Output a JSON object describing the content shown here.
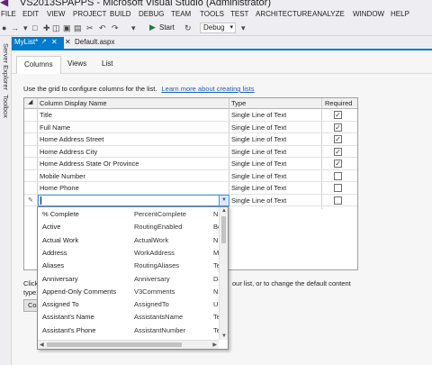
{
  "window": {
    "title": "VS2013SPAPPS - Microsoft Visual Studio (Administrator)"
  },
  "menu": [
    "FILE",
    "EDIT",
    "VIEW",
    "PROJECT",
    "BUILD",
    "DEBUG",
    "TEAM",
    "TOOLS",
    "TEST",
    "ARCHITECTURE",
    "ANALYZE",
    "WINDOW",
    "HELP"
  ],
  "toolbar": {
    "start_label": "Start",
    "config_label": "Debug"
  },
  "side": {
    "server_explorer": "Server Explorer",
    "toolbox": "Toolbox"
  },
  "doc_tabs": {
    "active": "MyList*",
    "other": "Default.aspx"
  },
  "sub_tabs": [
    "Columns",
    "Views",
    "List"
  ],
  "instructions": {
    "text": "Use the grid to configure columns for the list.",
    "link": "Learn more about creating lists"
  },
  "grid": {
    "headers": {
      "name": "Column Display Name",
      "type": "Type",
      "required": "Required"
    },
    "rows": [
      {
        "name": "Title",
        "type": "Single Line of Text",
        "required": true
      },
      {
        "name": "Full Name",
        "type": "Single Line of Text",
        "required": true
      },
      {
        "name": "Home Address Street",
        "type": "Single Line of Text",
        "required": true
      },
      {
        "name": "Home Address City",
        "type": "Single Line of Text",
        "required": true
      },
      {
        "name": "Home Address State Or Province",
        "type": "Single Line of Text",
        "required": true
      },
      {
        "name": "Mobile Number",
        "type": "Single Line of Text",
        "required": false
      },
      {
        "name": "Home Phone",
        "type": "Single Line of Text",
        "required": false
      }
    ],
    "new_row": {
      "value": "",
      "type": "Single Line of Text",
      "required": false
    }
  },
  "below": {
    "left_line1": "Click",
    "left_line2": "type.",
    "right_text": "our list, or to change the default content",
    "button_label": "Co"
  },
  "dropdown": {
    "items": [
      {
        "display": "% Complete",
        "internal": "PercentComplete",
        "type": "N"
      },
      {
        "display": "Active",
        "internal": "RoutingEnabled",
        "type": "Bo"
      },
      {
        "display": "Actual Work",
        "internal": "ActualWork",
        "type": "N"
      },
      {
        "display": "Address",
        "internal": "WorkAddress",
        "type": "M"
      },
      {
        "display": "Aliases",
        "internal": "RoutingAliases",
        "type": "Te"
      },
      {
        "display": "Anniversary",
        "internal": "Anniversary",
        "type": "Da"
      },
      {
        "display": "Append-Only Comments",
        "internal": "V3Comments",
        "type": "N"
      },
      {
        "display": "Assigned To",
        "internal": "AssignedTo",
        "type": "Us"
      },
      {
        "display": "Assistant's Name",
        "internal": "AssistantsName",
        "type": "Te"
      },
      {
        "display": "Assistant's Phone",
        "internal": "AssistantNumber",
        "type": "Te"
      }
    ]
  }
}
